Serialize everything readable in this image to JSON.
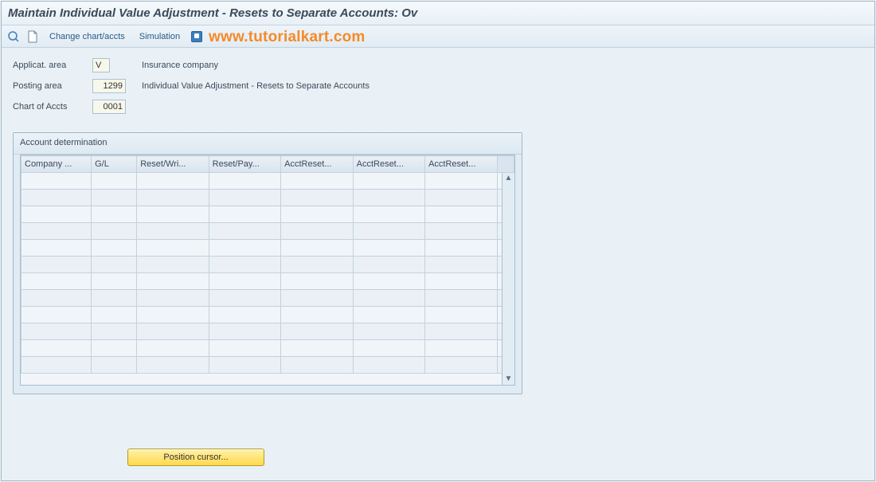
{
  "title": "Maintain Individual Value Adjustment - Resets to Separate Accounts: Ov",
  "watermark": "www.tutorialkart.com",
  "toolbar": {
    "change_chart_accts_label": "Change chart/accts",
    "simulation_label": "Simulation"
  },
  "form": {
    "applicat_area_label": "Applicat. area",
    "applicat_area_value": "V",
    "applicat_area_desc": "Insurance company",
    "posting_area_label": "Posting area",
    "posting_area_value": "1299",
    "posting_area_desc": "Individual Value Adjustment - Resets to Separate Accounts",
    "chart_of_accts_label": "Chart of Accts",
    "chart_of_accts_value": "0001"
  },
  "panel": {
    "title": "Account determination",
    "columns": [
      "Company ...",
      "G/L",
      "Reset/Wri...",
      "Reset/Pay...",
      "AcctReset...",
      "AcctReset...",
      "AcctReset..."
    ],
    "rows": [
      [
        "",
        "",
        "",
        "",
        "",
        "",
        ""
      ],
      [
        "",
        "",
        "",
        "",
        "",
        "",
        ""
      ],
      [
        "",
        "",
        "",
        "",
        "",
        "",
        ""
      ],
      [
        "",
        "",
        "",
        "",
        "",
        "",
        ""
      ],
      [
        "",
        "",
        "",
        "",
        "",
        "",
        ""
      ],
      [
        "",
        "",
        "",
        "",
        "",
        "",
        ""
      ],
      [
        "",
        "",
        "",
        "",
        "",
        "",
        ""
      ],
      [
        "",
        "",
        "",
        "",
        "",
        "",
        ""
      ],
      [
        "",
        "",
        "",
        "",
        "",
        "",
        ""
      ],
      [
        "",
        "",
        "",
        "",
        "",
        "",
        ""
      ],
      [
        "",
        "",
        "",
        "",
        "",
        "",
        ""
      ],
      [
        "",
        "",
        "",
        "",
        "",
        "",
        ""
      ]
    ]
  },
  "buttons": {
    "position_cursor": "Position cursor..."
  }
}
